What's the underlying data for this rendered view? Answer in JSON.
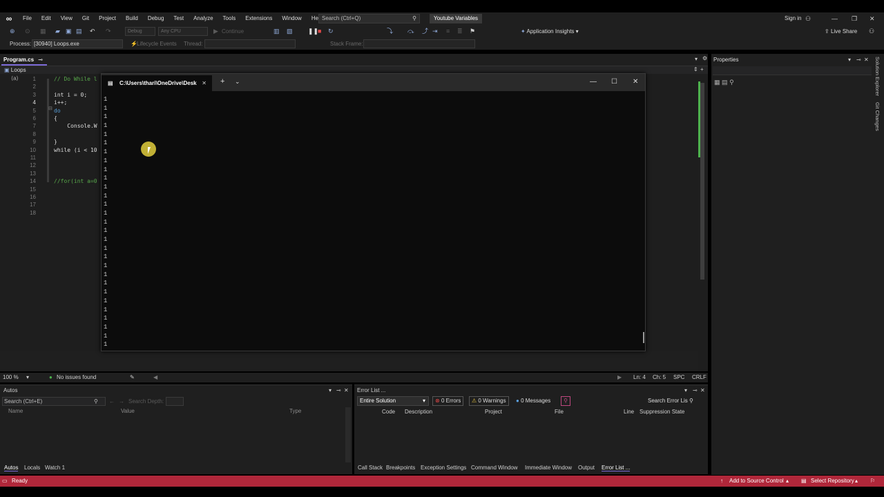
{
  "menu": {
    "items": [
      "File",
      "Edit",
      "View",
      "Git",
      "Project",
      "Build",
      "Debug",
      "Test",
      "Analyze",
      "Tools",
      "Extensions",
      "Window",
      "Help"
    ],
    "search_placeholder": "Search (Ctrl+Q)",
    "solution_name": "Youtube Variables",
    "sign_in": "Sign in"
  },
  "toolbar": {
    "config": "Debug",
    "platform": "Any CPU",
    "continue": "Continue",
    "app_insights": "Application Insights",
    "live_share": "Live Share"
  },
  "process_bar": {
    "process_label": "Process:",
    "process_value": "[30940] Loops.exe",
    "lifecycle": "Lifecycle Events",
    "thread": "Thread:",
    "stack_frame": "Stack Frame:"
  },
  "editor": {
    "tab": "Program.cs",
    "nav_scope": "Loops",
    "line_numbers": [
      "1",
      "2",
      "3",
      "4",
      "5",
      "6",
      "7",
      "8",
      "9",
      "10",
      "11",
      "12",
      "13",
      "14",
      "15",
      "16",
      "17",
      "18"
    ],
    "code_lines": [
      {
        "n": 1,
        "text": "// Do While l",
        "cls": "cm"
      },
      {
        "n": 3,
        "text": "int i = 0;",
        "cls": "tx"
      },
      {
        "n": 4,
        "text": "i++;",
        "cls": "tx"
      },
      {
        "n": 5,
        "text": "do",
        "cls": "kw"
      },
      {
        "n": 6,
        "text": "{",
        "cls": "tx"
      },
      {
        "n": 7,
        "text": "    Console.W",
        "cls": "tx"
      },
      {
        "n": 9,
        "text": "}",
        "cls": "tx"
      },
      {
        "n": 10,
        "text": "while (i < 10",
        "cls": "tx"
      },
      {
        "n": 14,
        "text": "//for(int a=0",
        "cls": "cm"
      }
    ],
    "zoom": "100 %",
    "issues": "No issues found",
    "ln": "Ln: 4",
    "ch": "Ch: 5",
    "spc": "SPC",
    "crlf": "CRLF"
  },
  "console": {
    "tab_title": "C:\\Users\\thari\\OneDrive\\Desk",
    "output_lines": [
      "1",
      "1",
      "1",
      "1",
      "1",
      "1",
      "1",
      "1",
      "1",
      "1",
      "1",
      "1",
      "1",
      "1",
      "1",
      "1",
      "1",
      "1",
      "1",
      "1",
      "1",
      "1",
      "1",
      "1",
      "1",
      "1",
      "1",
      "1",
      "1"
    ]
  },
  "properties": {
    "title": "Properties",
    "rail_items": [
      "Solution Explorer",
      "Git Changes"
    ]
  },
  "autos": {
    "title": "Autos",
    "search_placeholder": "Search (Ctrl+E)",
    "search_depth": "Search Depth:",
    "columns": [
      "Name",
      "Value",
      "Type"
    ],
    "tabs": [
      "Autos",
      "Locals",
      "Watch 1"
    ]
  },
  "error_list": {
    "title": "Error List ...",
    "scope": "Entire Solution",
    "errors": "0 Errors",
    "warnings": "0 Warnings",
    "messages": "0 Messages",
    "search_placeholder": "Search Error Lis",
    "columns": [
      "Code",
      "Description",
      "Project",
      "File",
      "Line",
      "Suppression State"
    ],
    "tabs": [
      "Call Stack",
      "Breakpoints",
      "Exception Settings",
      "Command Window",
      "Immediate Window",
      "Output",
      "Error List ..."
    ]
  },
  "status": {
    "ready": "Ready",
    "add_source": "Add to Source Control",
    "select_repo": "Select Repository"
  },
  "colors": {
    "status_bar": "#b0273a",
    "accent": "#7d6bd8",
    "cursor_highlight": "#d5c23a"
  }
}
